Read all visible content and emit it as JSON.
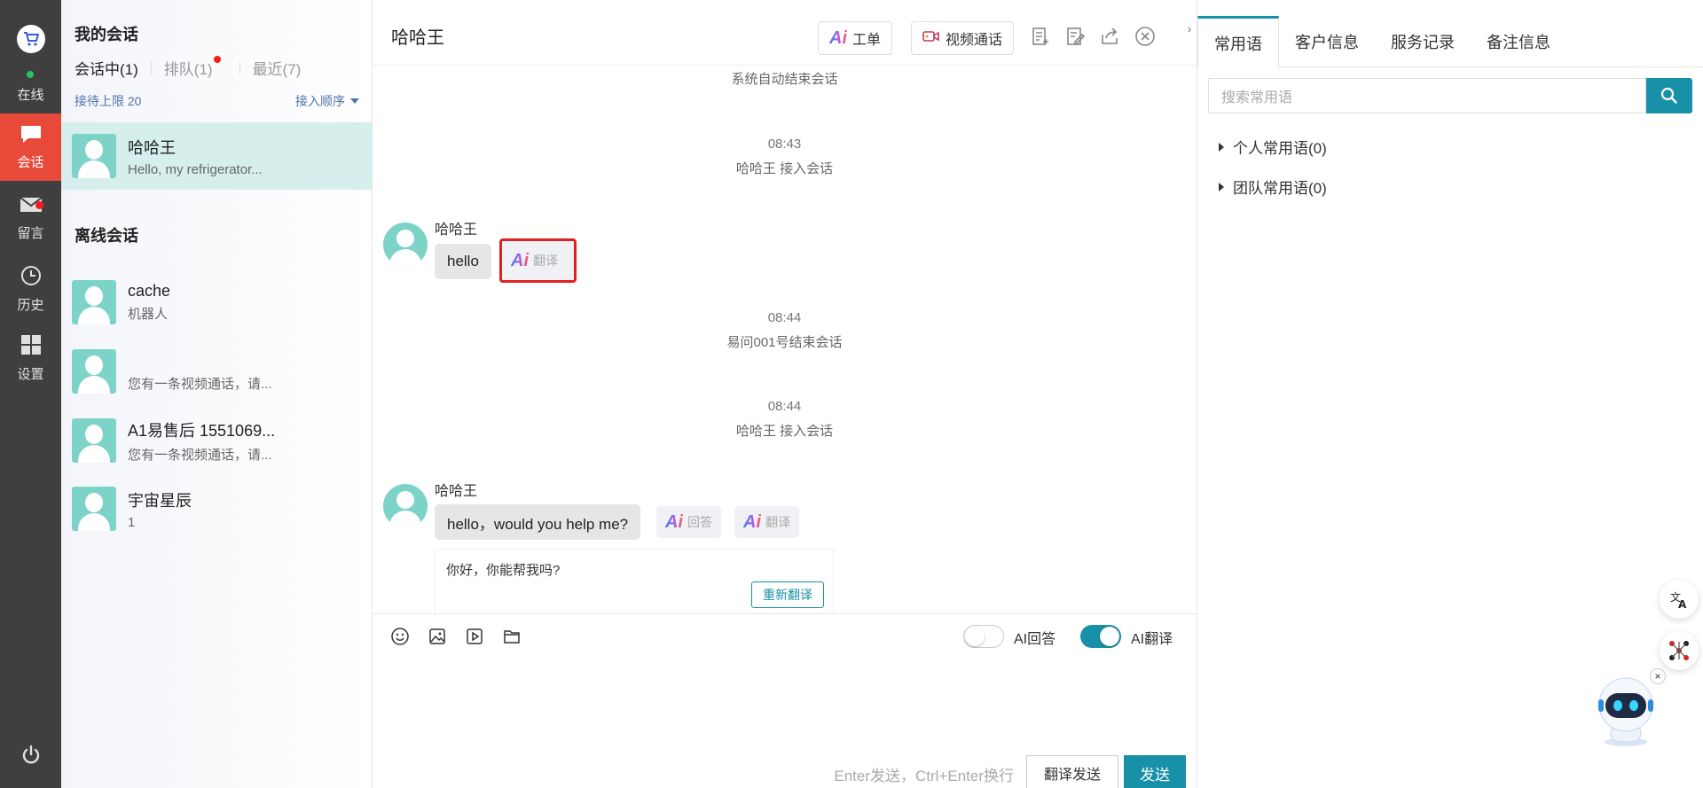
{
  "rail": {
    "status": "在线",
    "items": [
      {
        "label": "会话",
        "icon": "chat-icon",
        "active": true
      },
      {
        "label": "留言",
        "icon": "mail-icon",
        "badge": true
      },
      {
        "label": "历史",
        "icon": "clock-icon"
      },
      {
        "label": "设置",
        "icon": "grid-icon"
      }
    ],
    "colors": {
      "active": "#e84a3a",
      "online": "#22c55e"
    }
  },
  "sessions": {
    "title": "我的会话",
    "tabs": [
      {
        "label": "会话中(1)",
        "active": true
      },
      {
        "label": "排队(1)",
        "badge": true
      },
      {
        "label": "最近(7)"
      }
    ],
    "limit_label": "接待上限 20",
    "order_label": "接入顺序",
    "active_conversation": {
      "name": "哈哈王",
      "preview": "Hello, my refrigerator..."
    },
    "offline_title": "离线会话",
    "offline": [
      {
        "name": "cache",
        "preview": "机器人"
      },
      {
        "name": "",
        "preview": "您有一条视频通话，请..."
      },
      {
        "name": "A1易售后 1551069...",
        "preview": "您有一条视频通话，请..."
      },
      {
        "name": "宇宙星辰",
        "preview": "1"
      }
    ]
  },
  "chat": {
    "title": "哈哈王",
    "header_buttons": {
      "ticket": "工单",
      "video": "视频通话",
      "ai": "Ai"
    },
    "messages": {
      "sys1": "系统自动结束会话",
      "time1": "08:43",
      "sys2": "哈哈王 接入会话",
      "sender1": "哈哈王",
      "bubble1": "hello",
      "chip_translate": "翻译",
      "time2": "08:44",
      "sys3": "易问001号结束会话",
      "time3": "08:44",
      "sys4": "哈哈王 接入会话",
      "sender2": "哈哈王",
      "bubble2": "hello，would you help me?",
      "chip_reply": "回答",
      "chip_translate2": "翻译",
      "translation": "你好，你能帮我吗?",
      "retranslate": "重新翻译"
    },
    "composer": {
      "ai_reply_label": "AI回答",
      "ai_reply_on": false,
      "ai_translate_label": "AI翻译",
      "ai_translate_on": true,
      "hint": "Enter发送，Ctrl+Enter换行",
      "translate_send": "翻译发送",
      "send": "发送"
    },
    "accent": "#1890a8"
  },
  "right": {
    "tabs": [
      "常用语",
      "客户信息",
      "服务记录",
      "备注信息"
    ],
    "active_tab": 0,
    "search_placeholder": "搜索常用语",
    "groups": [
      "个人常用语(0)",
      "团队常用语(0)"
    ]
  }
}
